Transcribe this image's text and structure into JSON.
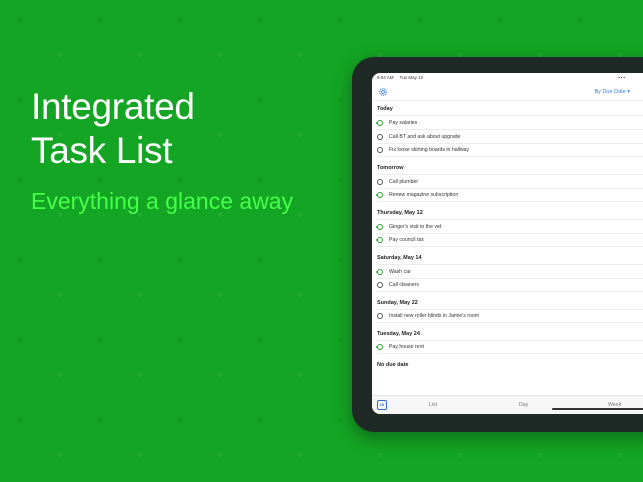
{
  "promo": {
    "headline_line1": "Integrated",
    "headline_line2": "Task List",
    "tagline": "Everything a glance away"
  },
  "colors": {
    "background": "#14a524",
    "tagline": "#46ff4a",
    "accent_blue": "#3a7be0",
    "repeat_green": "#2fa835"
  },
  "status_bar": {
    "time": "9:04 AM",
    "date": "Tue May 10",
    "dots": "•••"
  },
  "navbar": {
    "settings_icon": "gear-icon",
    "sort_label": "By Due Date ▾"
  },
  "sections": [
    {
      "title": "Today",
      "tasks": [
        {
          "label": "Pay salaries",
          "repeat": true
        },
        {
          "label": "Call BT and ask about upgrade",
          "repeat": false
        },
        {
          "label": "Fix loose skirting boards in hallway",
          "repeat": false
        }
      ]
    },
    {
      "title": "Tomorrow",
      "tasks": [
        {
          "label": "Call plumber",
          "repeat": false
        },
        {
          "label": "Renew magazine subscription",
          "repeat": true
        }
      ]
    },
    {
      "title": "Thursday, May 12",
      "tasks": [
        {
          "label": "Ginger's visit to the vet",
          "repeat": true
        },
        {
          "label": "Pay council tax",
          "repeat": true
        }
      ]
    },
    {
      "title": "Saturday, May 14",
      "tasks": [
        {
          "label": "Wash car",
          "repeat": true
        },
        {
          "label": "Call cleaners",
          "repeat": false
        }
      ]
    },
    {
      "title": "Sunday, May 22",
      "tasks": [
        {
          "label": "Install new roller blinds in Jamie's room",
          "repeat": false
        }
      ]
    },
    {
      "title": "Tuesday, May 24",
      "tasks": [
        {
          "label": "Pay house rent",
          "repeat": true
        }
      ]
    },
    {
      "title": "No due date",
      "tasks": []
    }
  ],
  "tabbar": {
    "calendar_day": "10",
    "tabs": [
      "List",
      "Day",
      "Week"
    ]
  }
}
